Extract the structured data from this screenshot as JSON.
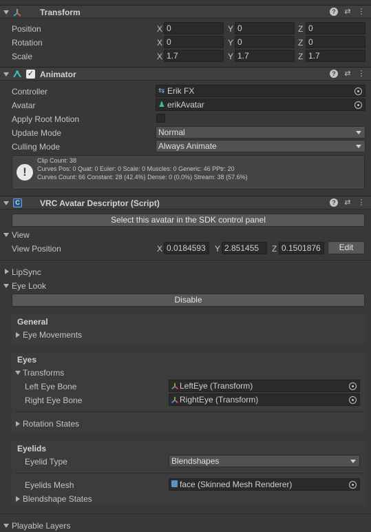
{
  "transform": {
    "title": "Transform",
    "rows": [
      {
        "label": "Position",
        "x": "0",
        "y": "0",
        "z": "0"
      },
      {
        "label": "Rotation",
        "x": "0",
        "y": "0",
        "z": "0"
      },
      {
        "label": "Scale",
        "x": "1.7",
        "y": "1.7",
        "z": "1.7"
      }
    ],
    "axes": {
      "x": "X",
      "y": "Y",
      "z": "Z"
    }
  },
  "animator": {
    "title": "Animator",
    "enabled": true,
    "controller_label": "Controller",
    "controller_value": "Erik FX",
    "avatar_label": "Avatar",
    "avatar_value": "erikAvatar",
    "apply_root_motion_label": "Apply Root Motion",
    "apply_root_motion": false,
    "update_mode_label": "Update Mode",
    "update_mode_value": "Normal",
    "culling_mode_label": "Culling Mode",
    "culling_mode_value": "Always Animate",
    "info": {
      "line1": "Clip Count: 38",
      "line2": "Curves Pos: 0 Quat: 0 Euler: 0 Scale: 0 Muscles: 0 Generic: 46 PPtr: 20",
      "line3": "Curves Count: 66 Constant: 28 (42.4%) Dense: 0 (0.0%) Stream: 38 (57.6%)"
    }
  },
  "descriptor": {
    "title": "VRC Avatar Descriptor (Script)",
    "select_button": "Select this avatar in the SDK control panel",
    "view_section": "View",
    "view_position_label": "View Position",
    "view_x": "0.0184593",
    "view_y": "2.851455",
    "view_z": "0.1501876",
    "edit_button": "Edit",
    "lipsync_section": "LipSync",
    "eyelook_section": "Eye Look",
    "disable_button": "Disable",
    "general_heading": "General",
    "eye_movements": "Eye Movements",
    "eyes_heading": "Eyes",
    "transforms_label": "Transforms",
    "left_eye_label": "Left Eye Bone",
    "left_eye_value": "LeftEye (Transform)",
    "right_eye_label": "Right Eye Bone",
    "right_eye_value": "RightEye (Transform)",
    "rotation_states": "Rotation States",
    "eyelids_heading": "Eyelids",
    "eyelid_type_label": "Eyelid Type",
    "eyelid_type_value": "Blendshapes",
    "eyelids_mesh_label": "Eyelids Mesh",
    "eyelids_mesh_value": "face (Skinned Mesh Renderer)",
    "blendshape_states": "Blendshape States",
    "playable_layers": "Playable Layers"
  },
  "colors": {
    "accent_transform": "#4a9fe0",
    "accent_animator": "#3cc0c0",
    "panel_bg": "#383838"
  }
}
